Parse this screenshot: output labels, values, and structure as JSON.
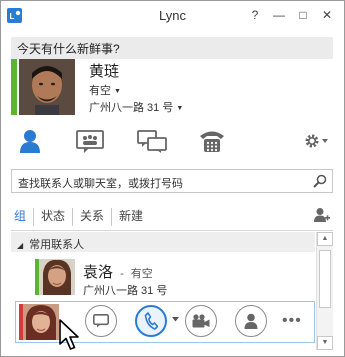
{
  "app": {
    "title": "Lync"
  },
  "window_controls": {
    "help": "?",
    "minimize": "—",
    "maximize": "□",
    "close": "✕"
  },
  "note": {
    "prompt": "今天有什么新鲜事?"
  },
  "me": {
    "name": "黄琏",
    "status": "有空",
    "location": "广州八一路 31 号",
    "presence_color": "#5cb531"
  },
  "tabs": [
    {
      "name": "contacts",
      "icon": "person-icon",
      "active": true
    },
    {
      "name": "conversations",
      "icon": "group-chat-icon"
    },
    {
      "name": "history",
      "icon": "conversation-history-icon"
    },
    {
      "name": "phone",
      "icon": "phone-icon"
    }
  ],
  "options_icon": "gear-icon",
  "search": {
    "placeholder": "查找联系人或聊天室，或拨打号码"
  },
  "filters": [
    "组",
    "状态",
    "关系",
    "新建"
  ],
  "group": {
    "label": "常用联系人"
  },
  "contacts": [
    {
      "name": "袁洛",
      "separator": " - ",
      "status": "有空",
      "location": "广州八一路 31 号",
      "presence_color": "#5cb531"
    }
  ],
  "hovered_contact": {
    "presence_color": "#d63b3b"
  },
  "quick_actions": [
    {
      "name": "im-button",
      "icon": "chat-bubble-icon"
    },
    {
      "name": "call-button",
      "icon": "phone-icon",
      "primary": true
    },
    {
      "name": "video-button",
      "icon": "video-camera-icon"
    },
    {
      "name": "contact-card-button",
      "icon": "person-icon"
    }
  ],
  "more_label": "•••",
  "colors": {
    "accent": "#2a7bd1",
    "available": "#5cb531",
    "busy": "#d63b3b"
  }
}
